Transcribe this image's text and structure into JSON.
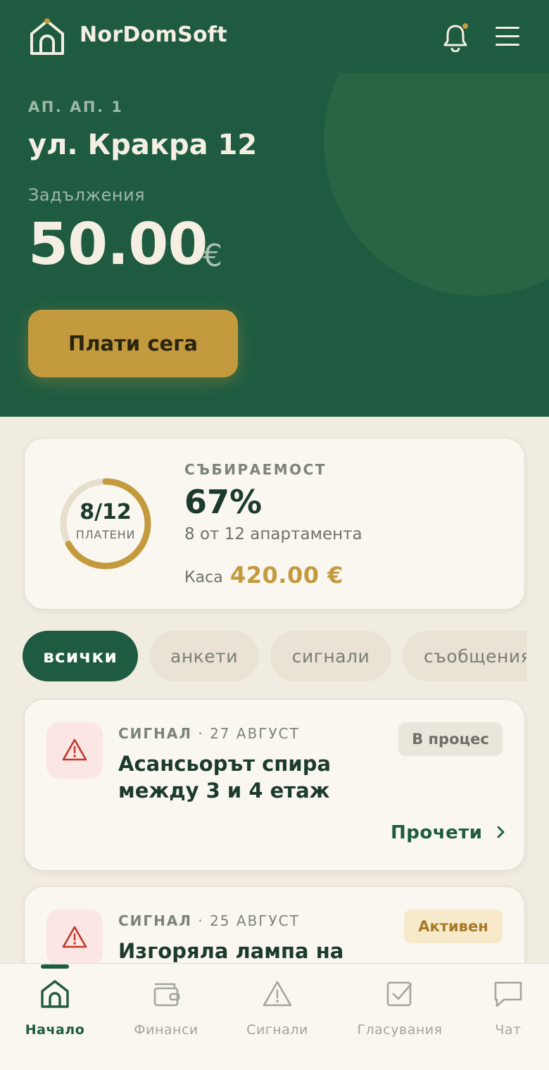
{
  "brand": {
    "name": "NorDomSoft"
  },
  "colors": {
    "primary": "#1e5b40",
    "accent": "#c39a3e",
    "background": "#f1ece1"
  },
  "header": {
    "logo_icon": "house-icon",
    "notification_icon": "bell-icon",
    "notification_dot": true,
    "menu_icon": "hamburger-menu-icon"
  },
  "apartment": {
    "label": "АП. АП. 1",
    "address": "ул. Кракра 12",
    "debt_label": "Задължения",
    "debt_amount": "50.00",
    "currency": "€",
    "pay_button": "Плати сега"
  },
  "collection": {
    "paid_fraction": 0.67,
    "ring_count": "8/12",
    "ring_label": "ПЛАТЕНИ",
    "title": "СЪБИРАЕМОСТ",
    "percent": "67%",
    "subtitle": "8 от 12 апартамента",
    "cash_label": "Каса",
    "cash_value": "420.00 €"
  },
  "filters": {
    "selected": "всички",
    "items": [
      "всички",
      "анкети",
      "сигнали",
      "съобщения"
    ]
  },
  "feed": [
    {
      "type": "СИГНАЛ",
      "date": "27 АВГУСТ",
      "title": "Асансьорът спира между 3 и 4 етаж",
      "status": "В процес",
      "icon": "warning-triangle-icon",
      "action": "Прочети",
      "action_icon": "chevron-right-icon"
    },
    {
      "type": "СИГНАЛ",
      "date": "25 АВГУСТ",
      "title": "Изгоряла лампа на",
      "status": "Активен",
      "icon": "warning-triangle-icon"
    }
  ],
  "nav": {
    "active": "Начало",
    "items": [
      {
        "label": "Начало",
        "icon": "home-icon"
      },
      {
        "label": "Финанси",
        "icon": "wallet-icon"
      },
      {
        "label": "Сигнали",
        "icon": "warning-triangle-icon"
      },
      {
        "label": "Гласувания",
        "icon": "checkbox-icon"
      },
      {
        "label": "Чат",
        "icon": "chat-bubble-icon"
      }
    ]
  }
}
